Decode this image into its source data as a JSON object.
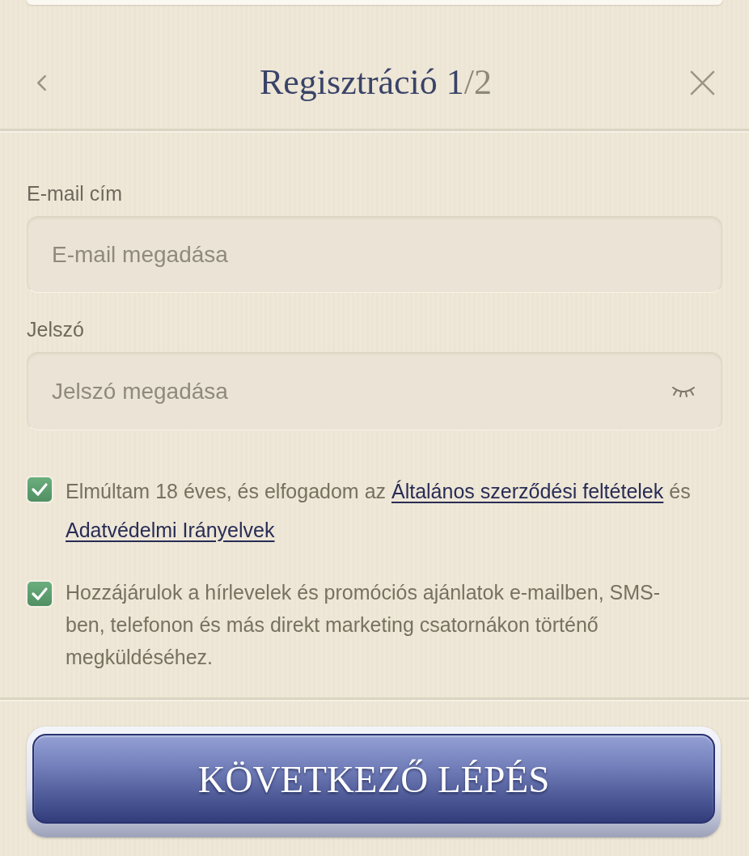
{
  "header": {
    "title": "Regisztráció",
    "step_current": "1",
    "step_rest": "/2"
  },
  "fields": [
    {
      "kind": "email",
      "label": "E-mail cím",
      "placeholder": "E-mail megadása"
    },
    {
      "kind": "password",
      "label": "Jelszó",
      "placeholder": "Jelszó megadása"
    }
  ],
  "consents": [
    {
      "checked": true,
      "parts": [
        {
          "kind": "text",
          "text": "Elmúltam 18 éves, és elfogadom az "
        },
        {
          "kind": "link",
          "text": "Általános szerződési feltételek"
        },
        {
          "kind": "text",
          "text": " és "
        },
        {
          "kind": "link",
          "text": "Adatvédelmi Irányelvek"
        }
      ]
    },
    {
      "checked": true,
      "parts": [
        {
          "kind": "text",
          "text": "Hozzájárulok a hírlevelek és promóciós ajánlatok e-mailben, SMS-ben, telefonon és más direkt marketing csatornákon történő megküldéséhez."
        }
      ]
    }
  ],
  "next_button": {
    "label": "KÖVETKEZŐ LÉPÉS"
  }
}
